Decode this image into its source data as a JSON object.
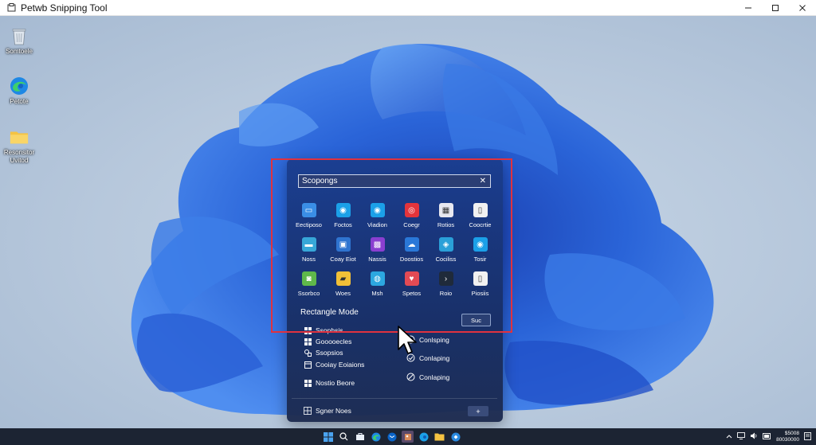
{
  "window": {
    "title": "Petwb Snipping Tool"
  },
  "desktop_icons": [
    {
      "name": "recycle-bin",
      "label": "Somtoele"
    },
    {
      "name": "edge",
      "label": "Petote"
    },
    {
      "name": "folder",
      "label": "Resonsitor\nUvitod"
    }
  ],
  "panel": {
    "search_value": "Scopongs",
    "tiles": [
      {
        "label": "Eectiposo",
        "icon": "monitor",
        "color": "#3a8ee6"
      },
      {
        "label": "Foctos",
        "icon": "edge",
        "color": "#1ba0e8"
      },
      {
        "label": "Viadion",
        "icon": "edge",
        "color": "#1ba0e8"
      },
      {
        "label": "Coegr",
        "icon": "red-app",
        "color": "#e2343b"
      },
      {
        "label": "Rotios",
        "icon": "calendar",
        "color": "#e8e8f0"
      },
      {
        "label": "Coocrtie",
        "icon": "document",
        "color": "#f1f1f1"
      },
      {
        "label": "Noss",
        "icon": "screen",
        "color": "#37a7d8"
      },
      {
        "label": "Coay Eiot",
        "icon": "store",
        "color": "#2f74d0"
      },
      {
        "label": "Nassis",
        "icon": "purple-app",
        "color": "#8a3fd0"
      },
      {
        "label": "Doostios",
        "icon": "cloud",
        "color": "#2a78d8"
      },
      {
        "label": "Cociliss",
        "icon": "settings",
        "color": "#2aa0d8"
      },
      {
        "label": "Tosir",
        "icon": "edge",
        "color": "#1ba0e8"
      },
      {
        "label": "Ssorbco",
        "icon": "camera",
        "color": "#5fb84a"
      },
      {
        "label": "Woes",
        "icon": "folder",
        "color": "#f2c037"
      },
      {
        "label": "Msh",
        "icon": "globe",
        "color": "#2ca7e0"
      },
      {
        "label": "Spetos",
        "icon": "heart",
        "color": "#e24a54"
      },
      {
        "label": "Roio",
        "icon": "terminal",
        "color": "#1f2a3a"
      },
      {
        "label": "Piosiis",
        "icon": "document",
        "color": "#f1f1f1"
      }
    ],
    "mode_title": "Rectangle Mode",
    "mode_button": "Suc",
    "left_options": [
      "Ssophsis",
      "Gooooecles",
      "Ssopsios",
      "Cooiay Eoiaions",
      "Nostio Beore"
    ],
    "right_options": [
      "Conlsping",
      "Conlaping",
      "Conlaping"
    ],
    "footer_label": "Sgner Noes",
    "add_label": "+"
  },
  "taskbar": {
    "clock_time": "$5008",
    "clock_date": "80030000"
  }
}
